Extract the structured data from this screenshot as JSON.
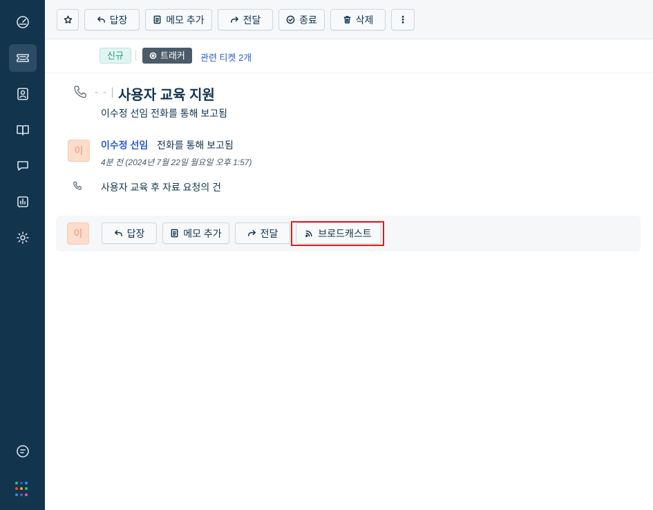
{
  "sidebar": {
    "items": [
      {
        "name": "dashboard",
        "icon": "gauge-icon",
        "active": false
      },
      {
        "name": "tickets",
        "icon": "ticket-icon",
        "active": true
      },
      {
        "name": "contacts",
        "icon": "contact-icon",
        "active": false
      },
      {
        "name": "knowledge",
        "icon": "book-icon",
        "active": false
      },
      {
        "name": "conversations",
        "icon": "chat-icon",
        "active": false
      },
      {
        "name": "reports",
        "icon": "chart-icon",
        "active": false
      },
      {
        "name": "settings",
        "icon": "gear-icon",
        "active": false
      }
    ],
    "bottom_icon": "message-icon",
    "app_grid_colors": [
      "#3fbf6f",
      "#2c5cc5",
      "#1aa0e0",
      "#e54b4b",
      "#f5a623",
      "#3fbf6f",
      "#1aa0e0",
      "#8e44ad",
      "#e85a9b"
    ]
  },
  "toolbar": {
    "reply": "답장",
    "add_note": "메모 추가",
    "forward": "전달",
    "close": "종료",
    "delete": "삭제",
    "more": "⋮"
  },
  "tags": {
    "status": "신규",
    "tracker": "트래커",
    "related": "관련 티켓 2개"
  },
  "ticket": {
    "prefix": "- - |",
    "title": "사용자 교육 지원",
    "subtitle": "이수정 선임 전화를 통해 보고됨"
  },
  "message": {
    "avatar": "이",
    "author": "이수정 선임",
    "via": "전화를 통해 보고됨",
    "time": "4분 전 (2024년 7월 22일 월요일 오후 1:57)",
    "body": "사용자 교육 후 자료 요청의 건"
  },
  "reply_bar": {
    "avatar": "이",
    "reply": "답장",
    "add_note": "메모 추가",
    "forward": "전달",
    "broadcast": "브로드캐스트"
  },
  "colors": {
    "sidebar": "#12344d",
    "link": "#2c5cc5",
    "highlight": "#e01b1b"
  }
}
